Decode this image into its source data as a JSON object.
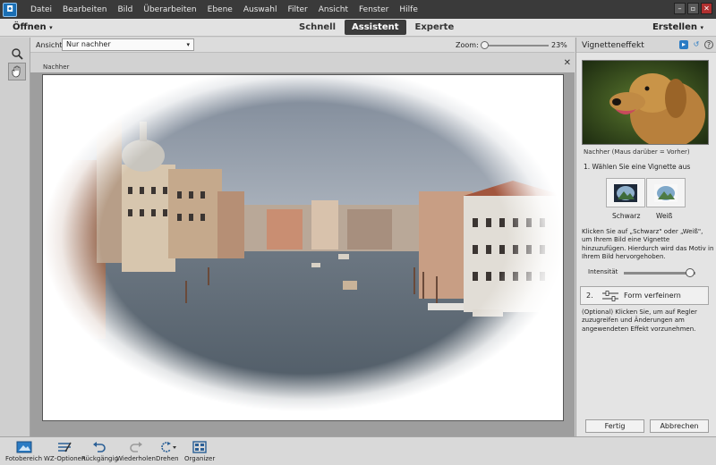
{
  "menubar": {
    "items": [
      "Datei",
      "Bearbeiten",
      "Bild",
      "Überarbeiten",
      "Ebene",
      "Auswahl",
      "Filter",
      "Ansicht",
      "Fenster",
      "Hilfe"
    ]
  },
  "modebar": {
    "open_label": "Öffnen",
    "tabs": [
      "Schnell",
      "Assistent",
      "Experte"
    ],
    "active_tab": "Assistent",
    "create_label": "Erstellen"
  },
  "options": {
    "view_label": "Ansicht:",
    "view_value": "Nur nachher",
    "zoom_label": "Zoom:",
    "zoom_value": "23%",
    "zoom_fraction": 0.23
  },
  "document": {
    "label": "Nachher",
    "close_glyph": "✕"
  },
  "panel": {
    "title": "Vignetteneffekt",
    "preview_caption": "Nachher (Maus darüber = Vorher)",
    "step1": "1. Wählen Sie eine Vignette aus",
    "vignette_black": "Schwarz",
    "vignette_white": "Weiß",
    "description1": "Klicken Sie auf „Schwarz\" oder „Weiß\", um Ihrem Bild eine Vignette hinzuzufügen. Hierdurch wird das Motiv in Ihrem Bild hervorgehoben.",
    "intensity_label": "Intensität",
    "intensity_fraction": 0.92,
    "step2_number": "2.",
    "step2_label": "Form verfeinern",
    "description2": "(Optional) Klicken Sie, um auf Regler zuzugreifen und Änderungen am angewendeten Effekt vorzunehmen.",
    "done_label": "Fertig",
    "cancel_label": "Abbrechen"
  },
  "taskbar": {
    "items": [
      "Fotobereich",
      "WZ-Optionen",
      "Rückgängig",
      "Wiederholen",
      "Drehen",
      "Organizer"
    ]
  },
  "colors": {
    "menubar_bg": "#3a3a3a",
    "active_tab_bg": "#3b3b3b",
    "accent_blue": "#2a7bc4"
  }
}
